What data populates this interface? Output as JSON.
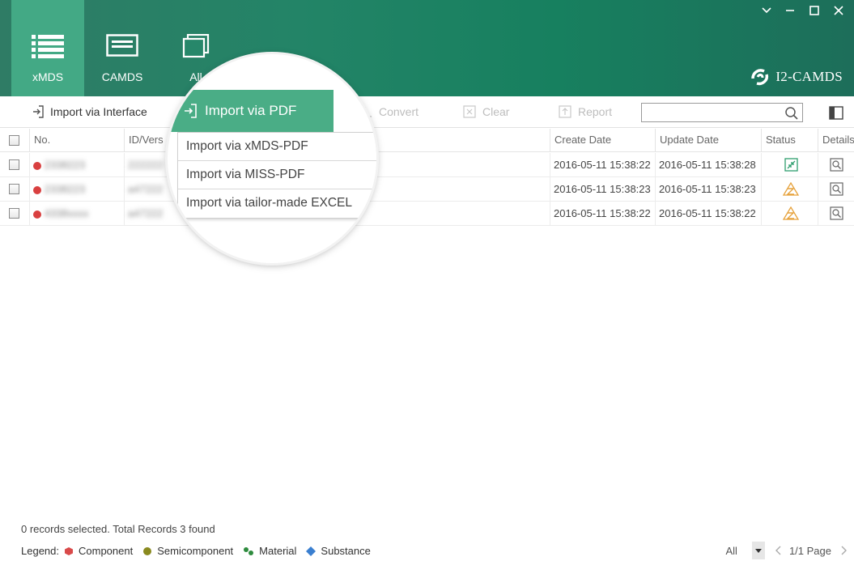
{
  "nav": {
    "tabs": [
      {
        "label": "xMDS",
        "icon": "list-icon"
      },
      {
        "label": "CAMDS",
        "icon": "window-list-icon"
      },
      {
        "label": "All",
        "icon": "stacked-windows-icon"
      }
    ]
  },
  "app": {
    "title": "I2-CAMDS"
  },
  "toolbar": {
    "import_interface": "Import via Interface",
    "convert": "Convert",
    "clear": "Clear",
    "report": "Report",
    "search_value": ""
  },
  "magnifier": {
    "main_button": "Import via PDF",
    "menu": [
      "Import via xMDS-PDF",
      "Import via MISS-PDF",
      "Import via tailor-made EXCEL"
    ]
  },
  "table": {
    "columns": [
      "No.",
      "ID/Vers",
      "Create Date",
      "Update Date",
      "Status",
      "Details"
    ],
    "rows": [
      {
        "no": "2338223",
        "id": "222222",
        "create": "2016-05-11 15:38:22",
        "update": "2016-05-11 15:38:28",
        "status": "compress-icon",
        "status_color": "#2e9e6e"
      },
      {
        "no": "2338223",
        "id": "a47222",
        "create": "2016-05-11 15:38:23",
        "update": "2016-05-11 15:38:23",
        "status": "warning-z-icon",
        "status_color": "#e6a23c"
      },
      {
        "no": "4338xxxx",
        "id": "a47222",
        "create": "2016-05-11 15:38:22",
        "update": "2016-05-11 15:38:22",
        "status": "warning-z-icon",
        "status_color": "#e6a23c"
      }
    ]
  },
  "footer": {
    "status": "0 records selected. Total Records 3 found",
    "legend_label": "Legend:",
    "legend": [
      {
        "label": "Component",
        "color": "#d94a4a"
      },
      {
        "label": "Semicomponent",
        "color": "#8a8a1f"
      },
      {
        "label": "Material",
        "color": "#2e8b3e"
      },
      {
        "label": "Substance",
        "color": "#3a7fd0"
      }
    ],
    "filter": "All",
    "page": "1/1 Page"
  },
  "colors": {
    "header_start": "#2f7c65",
    "header_accent": "#43a985",
    "menu_green": "#4aad86"
  }
}
